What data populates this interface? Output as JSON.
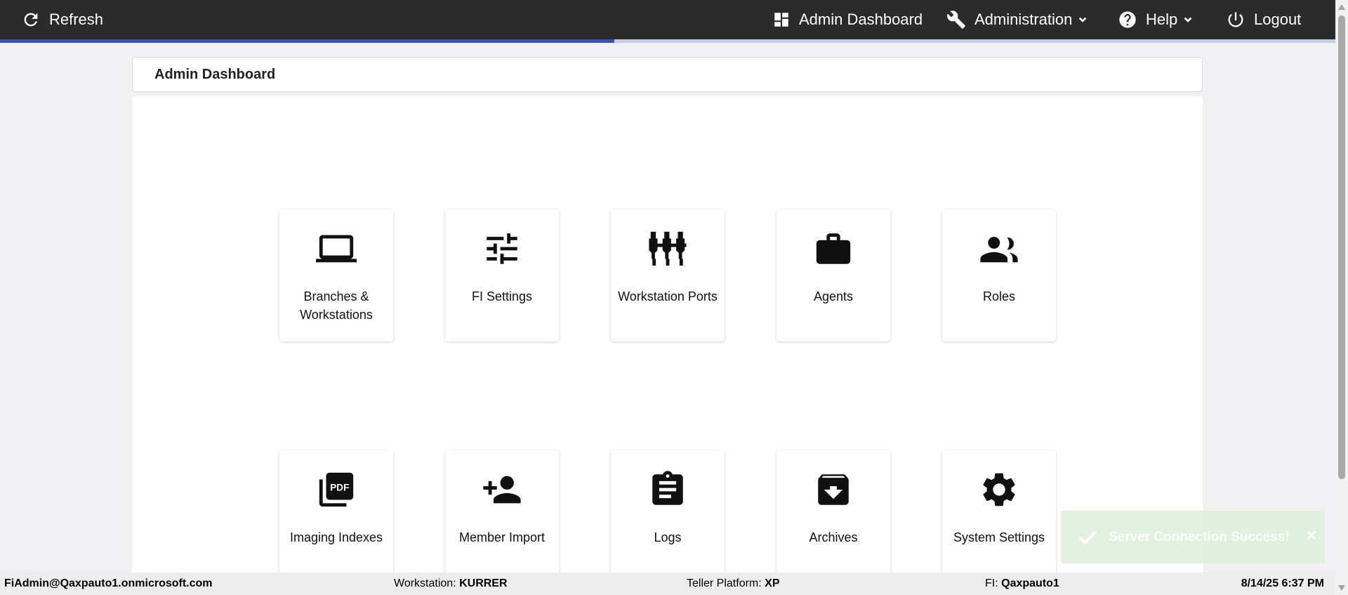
{
  "topbar": {
    "refresh_label": "Refresh",
    "admin_dashboard_label": "Admin Dashboard",
    "administration_label": "Administration",
    "help_label": "Help",
    "logout_label": "Logout"
  },
  "progress": {
    "fraction": 0.46
  },
  "page": {
    "title": "Admin Dashboard"
  },
  "tiles": [
    {
      "label": "Branches & Workstations",
      "icon": "laptop-icon"
    },
    {
      "label": "FI Settings",
      "icon": "tune-sliders-icon"
    },
    {
      "label": "Workstation Ports",
      "icon": "ports-icon"
    },
    {
      "label": "Agents",
      "icon": "briefcase-icon"
    },
    {
      "label": "Roles",
      "icon": "people-icon"
    },
    {
      "label": "Imaging Indexes",
      "icon": "pdf-icon"
    },
    {
      "label": "Member Import",
      "icon": "person-add-icon"
    },
    {
      "label": "Logs",
      "icon": "clipboard-icon"
    },
    {
      "label": "Archives",
      "icon": "archive-icon"
    },
    {
      "label": "System Settings",
      "icon": "gear-icon"
    }
  ],
  "toast": {
    "message": "Server Connection Success!",
    "close": "×"
  },
  "status": {
    "user": "FiAdmin@Qaxpauto1.onmicrosoft.com",
    "workstation_label": "Workstation:",
    "workstation_value": "KURRER",
    "platform_label": "Teller Platform:",
    "platform_value": "XP",
    "fi_label": "FI:",
    "fi_value": "Qaxpauto1",
    "datetime": "8/14/25 6:37 PM"
  },
  "colors": {
    "topbar": "#2b2b2b",
    "progress": "#3f51b5",
    "toast": "#dff0dd"
  }
}
